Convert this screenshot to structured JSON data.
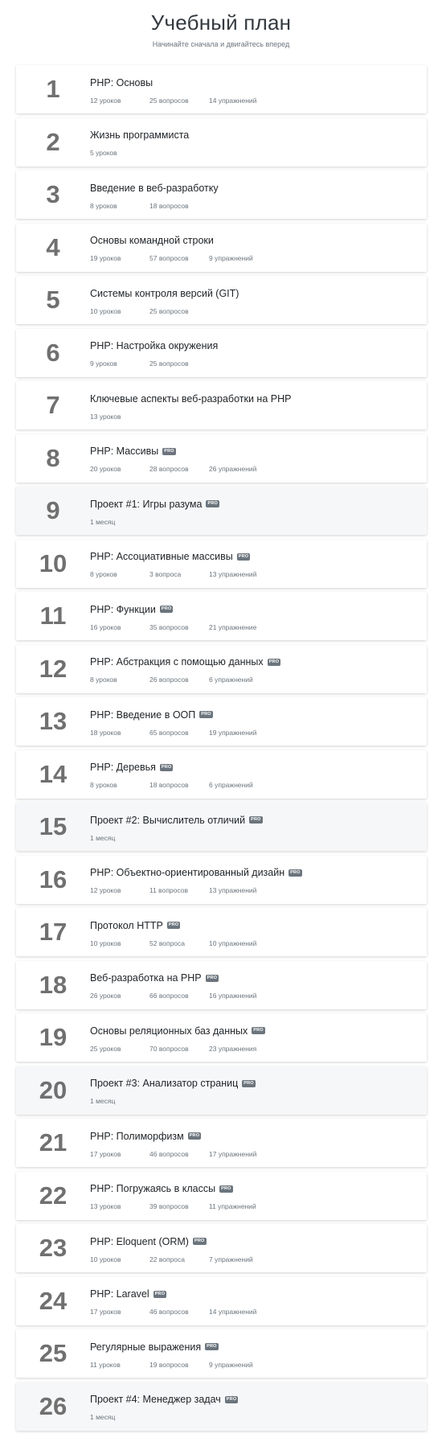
{
  "header": {
    "title": "Учебный план",
    "subtitle": "Начинайте сначала и двигайтесь вперед"
  },
  "items": [
    {
      "num": "1",
      "title": "PHP: Основы",
      "pro": "",
      "lessons": "12 уроков",
      "questions": "25 вопросов",
      "exercises": "14 упражнений",
      "project": false
    },
    {
      "num": "2",
      "title": "Жизнь программиста",
      "pro": "",
      "lessons": "5 уроков",
      "questions": "",
      "exercises": "",
      "project": false
    },
    {
      "num": "3",
      "title": "Введение в веб-разработку",
      "pro": "",
      "lessons": "8 уроков",
      "questions": "18 вопросов",
      "exercises": "",
      "project": false
    },
    {
      "num": "4",
      "title": "Основы командной строки",
      "pro": "",
      "lessons": "19 уроков",
      "questions": "57 вопросов",
      "exercises": "9 упражнений",
      "project": false
    },
    {
      "num": "5",
      "title": "Системы контроля версий (GIT)",
      "pro": "",
      "lessons": "10 уроков",
      "questions": "25 вопросов",
      "exercises": "",
      "project": false
    },
    {
      "num": "6",
      "title": "PHP: Настройка окружения",
      "pro": "",
      "lessons": "9 уроков",
      "questions": "25 вопросов",
      "exercises": "",
      "project": false
    },
    {
      "num": "7",
      "title": "Ключевые аспекты веб-разработки на PHP",
      "pro": "",
      "lessons": "13 уроков",
      "questions": "",
      "exercises": "",
      "project": false
    },
    {
      "num": "8",
      "title": "PHP: Массивы",
      "pro": "PRO",
      "lessons": "20 уроков",
      "questions": "28 вопросов",
      "exercises": "26 упражнений",
      "project": false
    },
    {
      "num": "9",
      "title": "Проект #1: Игры разума",
      "pro": "PRO",
      "lessons": "1 месяц",
      "questions": "",
      "exercises": "",
      "project": true
    },
    {
      "num": "10",
      "title": "PHP: Ассоциативные массивы",
      "pro": "PRO",
      "lessons": "8 уроков",
      "questions": "3 вопроса",
      "exercises": "13 упражнений",
      "project": false
    },
    {
      "num": "11",
      "title": "PHP: Функции",
      "pro": "PRO",
      "lessons": "16 уроков",
      "questions": "35 вопросов",
      "exercises": "21 упражнение",
      "project": false
    },
    {
      "num": "12",
      "title": "PHP: Абстракция с помощью данных",
      "pro": "PRO",
      "lessons": "8 уроков",
      "questions": "26 вопросов",
      "exercises": "6 упражнений",
      "project": false
    },
    {
      "num": "13",
      "title": "PHP: Введение в ООП",
      "pro": "PRO",
      "lessons": "18 уроков",
      "questions": "65 вопросов",
      "exercises": "19 упражнений",
      "project": false
    },
    {
      "num": "14",
      "title": "PHP: Деревья",
      "pro": "PRO",
      "lessons": "8 уроков",
      "questions": "18 вопросов",
      "exercises": "6 упражнений",
      "project": false
    },
    {
      "num": "15",
      "title": "Проект #2: Вычислитель отличий",
      "pro": "PRO",
      "lessons": "1 месяц",
      "questions": "",
      "exercises": "",
      "project": true
    },
    {
      "num": "16",
      "title": "PHP: Объектно-ориентированный дизайн",
      "pro": "PRO",
      "lessons": "12 уроков",
      "questions": "11 вопросов",
      "exercises": "13 упражнений",
      "project": false
    },
    {
      "num": "17",
      "title": "Протокол HTTP",
      "pro": "PRO",
      "lessons": "10 уроков",
      "questions": "52 вопроса",
      "exercises": "10 упражнений",
      "project": false
    },
    {
      "num": "18",
      "title": "Веб-разработка на PHP",
      "pro": "PRO",
      "lessons": "26 уроков",
      "questions": "66 вопросов",
      "exercises": "16 упражнений",
      "project": false
    },
    {
      "num": "19",
      "title": "Основы реляционных баз данных",
      "pro": "PRO",
      "lessons": "25 уроков",
      "questions": "70 вопросов",
      "exercises": "23 упражнения",
      "project": false
    },
    {
      "num": "20",
      "title": "Проект #3: Анализатор страниц",
      "pro": "PRO",
      "lessons": "1 месяц",
      "questions": "",
      "exercises": "",
      "project": true
    },
    {
      "num": "21",
      "title": "PHP: Полиморфизм",
      "pro": "PRO",
      "lessons": "17 уроков",
      "questions": "46 вопросов",
      "exercises": "17 упражнений",
      "project": false
    },
    {
      "num": "22",
      "title": "PHP: Погружаясь в классы",
      "pro": "PRO",
      "lessons": "13 уроков",
      "questions": "39 вопросов",
      "exercises": "11 упражнений",
      "project": false
    },
    {
      "num": "23",
      "title": "PHP: Eloquent (ORM)",
      "pro": "PRO",
      "lessons": "10 уроков",
      "questions": "22 вопроса",
      "exercises": "7 упражнений",
      "project": false
    },
    {
      "num": "24",
      "title": "PHP: Laravel",
      "pro": "PRO",
      "lessons": "17 уроков",
      "questions": "46 вопросов",
      "exercises": "14 упражнений",
      "project": false
    },
    {
      "num": "25",
      "title": "Регулярные выражения",
      "pro": "PRO",
      "lessons": "11 уроков",
      "questions": "19 вопросов",
      "exercises": "9 упражнений",
      "project": false
    },
    {
      "num": "26",
      "title": "Проект #4: Менеджер задач",
      "pro": "PRO",
      "lessons": "1 месяц",
      "questions": "",
      "exercises": "",
      "project": true
    }
  ]
}
